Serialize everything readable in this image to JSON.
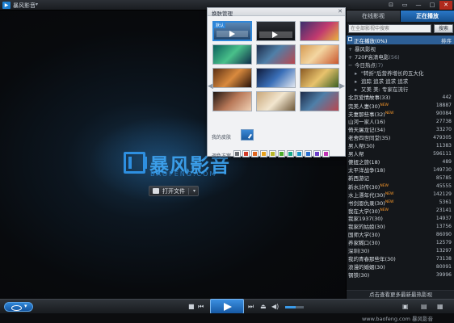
{
  "window": {
    "title": "暴风影音",
    "menu_arrow": "▾",
    "buttons": {
      "skin": "⊡",
      "mini": "▭",
      "minimize": "—",
      "maximize": "□",
      "close": "✕"
    }
  },
  "video": {
    "brand_cn": "暴风影音",
    "brand_en": "BAOFENG.COM",
    "open_button": {
      "label": "打开文件",
      "dropdown": "▾"
    }
  },
  "skin_popup": {
    "title": "换肤管理",
    "close": "✕",
    "prev": "◀",
    "next": "▶",
    "default_tag": "默认",
    "custom_label": "我的皮肤",
    "color_label": "调色方案",
    "swatch_colors": [
      "#6b6f75",
      "#d23b2a",
      "#e0661f",
      "#e7a21c",
      "#b7b62a",
      "#4cab2b",
      "#1aa98a",
      "#1895c9",
      "#2a6fd1",
      "#6b3fc9",
      "#c235b4"
    ]
  },
  "panel": {
    "tabs": [
      "在线影视",
      "正在播放"
    ],
    "search": {
      "placeholder": "在全部影视中搜索",
      "button": "搜索"
    },
    "top_row": {
      "label": "正在播放(0%)",
      "right": "排序"
    },
    "tree": [
      {
        "mark": "+",
        "label": "暴风影视",
        "count": ""
      },
      {
        "mark": "+",
        "label": "720P高清电影",
        "count": "(56)"
      },
      {
        "mark": "−",
        "label": "今日热点",
        "count": "(7)"
      },
      {
        "mark": "▸",
        "label": "\"转折\"后营养增长的五大化",
        "count": ""
      },
      {
        "mark": "▸",
        "label": "追踪 追求 追求 追求",
        "count": ""
      },
      {
        "mark": "▸",
        "label": "又美 美: 专家在流行",
        "count": ""
      }
    ],
    "list": [
      {
        "name": "北京爱情故事(33)",
        "value": "442",
        "new": false
      },
      {
        "name": "完美人妻(30)",
        "value": "18887",
        "new": true
      },
      {
        "name": "夫妻那些事(32)",
        "value": "90084",
        "new": true
      },
      {
        "name": "山河一家人(16)",
        "value": "27738",
        "new": false
      },
      {
        "name": "倚天屠龙记(34)",
        "value": "33270",
        "new": false
      },
      {
        "name": "老舍四世同堂(35)",
        "value": "479305",
        "new": false
      },
      {
        "name": "男人帮(30)",
        "value": "11383",
        "new": false
      },
      {
        "name": "男人帮",
        "value": "596111",
        "new": false
      },
      {
        "name": "傻妞之旅(18)",
        "value": "489",
        "new": false
      },
      {
        "name": "太平洋战争(18)",
        "value": "149730",
        "new": false
      },
      {
        "name": "新西游记",
        "value": "85785",
        "new": false
      },
      {
        "name": "新水浒传(30)",
        "value": "45555",
        "new": true
      },
      {
        "name": "水上漂年代(30)",
        "value": "142129",
        "new": true
      },
      {
        "name": "书剑恩仇录(30)",
        "value": "5361",
        "new": true
      },
      {
        "name": "我在大学(30)",
        "value": "23141",
        "new": true
      },
      {
        "name": "我家1937(30)",
        "value": "14937",
        "new": false
      },
      {
        "name": "我家的姑娘(30)",
        "value": "13756",
        "new": false
      },
      {
        "name": "国师大学(30)",
        "value": "86090",
        "new": false
      },
      {
        "name": "养家糊口(30)",
        "value": "12579",
        "new": false
      },
      {
        "name": "深圳(30)",
        "value": "13297",
        "new": false
      },
      {
        "name": "我的青春那些年(30)",
        "value": "73138",
        "new": false
      },
      {
        "name": "浪漫的婚姻(30)",
        "value": "80091",
        "new": false
      },
      {
        "name": "钢铁(30)",
        "value": "39996",
        "new": false
      }
    ],
    "footer": "点击查看更多最新最热影视"
  },
  "controls": {
    "stop": "■",
    "prev": "⏮",
    "next": "⏭",
    "eject": "⏏",
    "mute": "◀)",
    "volume_fraction": 0.55,
    "right_icons": [
      "▣",
      "▤",
      "▦"
    ]
  },
  "status": {
    "watermark": "www.baofeng.com 暴风影音"
  }
}
